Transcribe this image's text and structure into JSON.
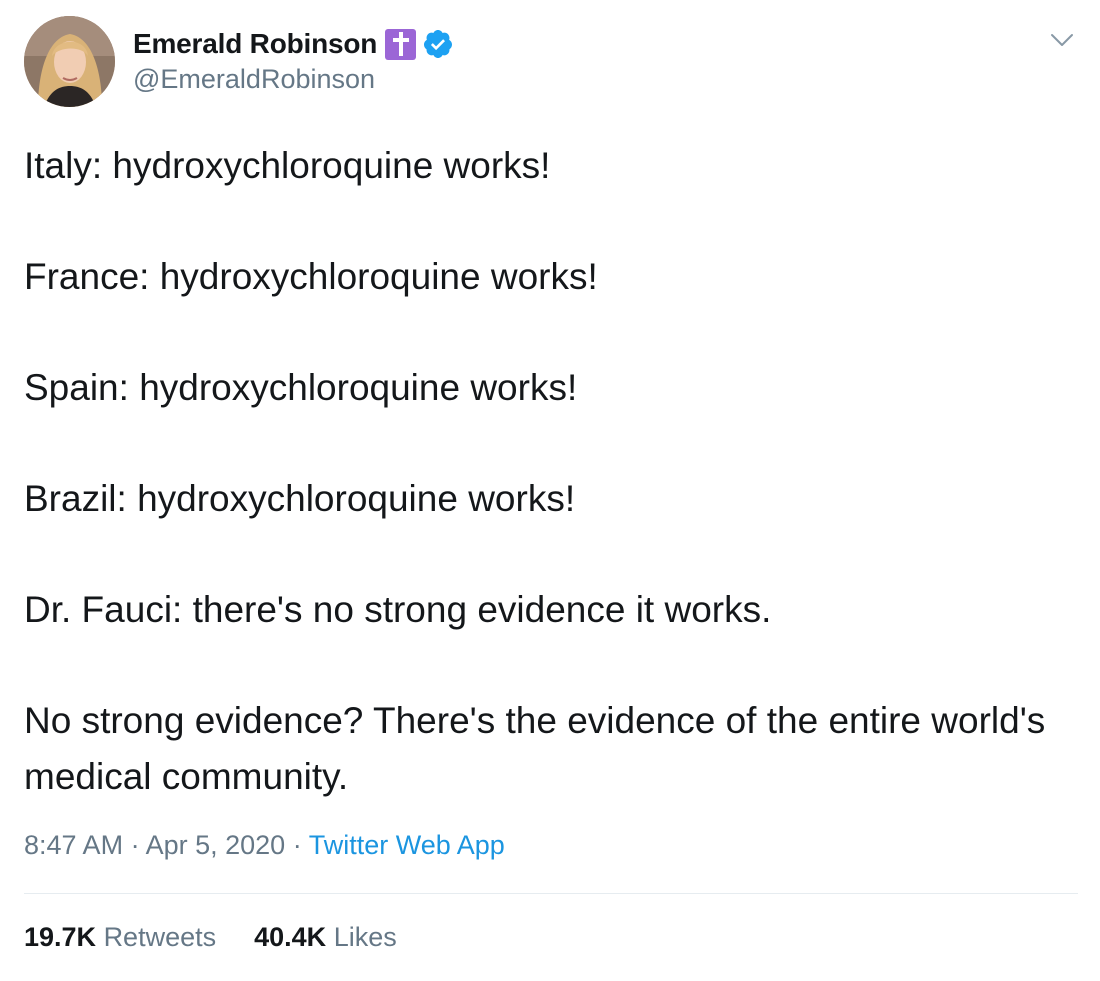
{
  "tweet": {
    "author": {
      "display_name": "Emerald Robinson",
      "handle": "@EmeraldRobinson",
      "badge_icon": "latin-cross-icon",
      "badge_color": "#9b66d6",
      "verified_icon": "verified-badge-icon",
      "verified_color": "#1da1f2"
    },
    "menu_icon": "chevron-down-icon",
    "lines": [
      "Italy: hydroxychloroquine works!",
      "France: hydroxychloroquine works!",
      "Spain: hydroxychloroquine works!",
      "Brazil: hydroxychloroquine works!",
      "Dr. Fauci: there's no strong evidence it works.",
      "No strong evidence? There's the evidence of the entire world's medical community."
    ],
    "meta": {
      "time": "8:47 AM",
      "separator": "·",
      "date": "Apr 5, 2020",
      "source": "Twitter Web App"
    },
    "stats": {
      "retweets_count": "19.7K",
      "retweets_label": "Retweets",
      "likes_count": "40.4K",
      "likes_label": "Likes"
    },
    "colors": {
      "text": "#14171a",
      "muted": "#657786",
      "link": "#1b95e0",
      "divider": "#e6ecf0"
    }
  }
}
